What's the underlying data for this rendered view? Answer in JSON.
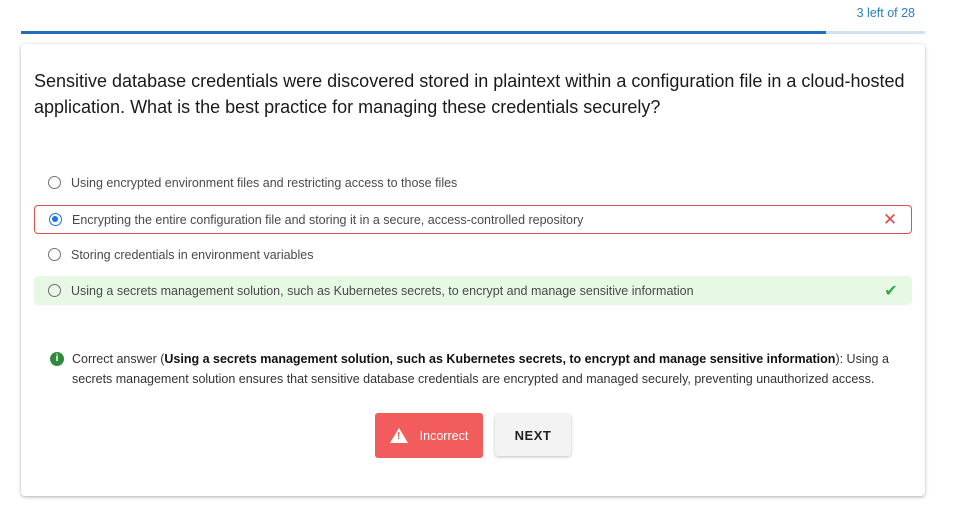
{
  "header": {
    "counter": "3 left of 28",
    "progress_fraction": 0.89
  },
  "question": {
    "text": "Sensitive database credentials were discovered stored in plaintext within a configuration file in a cloud-hosted application. What is the best practice for managing these credentials securely?"
  },
  "options": [
    {
      "label": "Using encrypted environment files and restricting access to those files",
      "state": "none"
    },
    {
      "label": "Encrypting the entire configuration file and storing it in a secure, access-controlled repository",
      "state": "selected-wrong"
    },
    {
      "label": "Storing credentials in environment variables",
      "state": "none"
    },
    {
      "label": "Using a secrets management solution, such as Kubernetes secrets, to encrypt and manage sensitive information",
      "state": "correct"
    }
  ],
  "explanation": {
    "prefix": "Correct answer (",
    "answer": "Using a secrets management solution, such as Kubernetes secrets, to encrypt and manage sensitive information",
    "suffix": "): Using a secrets management solution ensures that sensitive database credentials are encrypted and managed securely, preventing unauthorized access."
  },
  "buttons": {
    "result_label": "Incorrect",
    "next_label": "NEXT"
  },
  "icons": {
    "wrong": "close-icon",
    "correct": "check-icon",
    "info": "info-icon",
    "warning": "warning-icon"
  },
  "colors": {
    "accent": "#1f6fbf",
    "wrong": "#e04848",
    "correct_bg": "#e7f8e5",
    "incorrect_button": "#f25c5c"
  }
}
